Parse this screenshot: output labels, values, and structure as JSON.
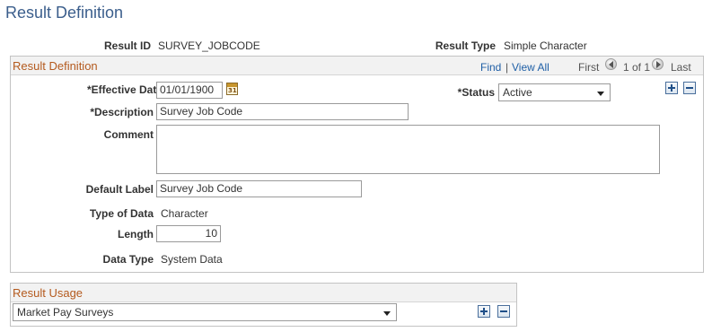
{
  "page": {
    "title": "Result Definition"
  },
  "summary": {
    "result_id_label": "Result ID",
    "result_id_value": "SURVEY_JOBCODE",
    "result_type_label": "Result Type",
    "result_type_value": "Simple Character"
  },
  "definition": {
    "title": "Result Definition",
    "nav": {
      "find": "Find",
      "separator": "|",
      "view_all": "View All",
      "first": "First",
      "count": "1 of 1",
      "last": "Last"
    },
    "effective_date_label": "*Effective Date",
    "effective_date_value": "01/01/1900",
    "calendar_icon_text": "31",
    "status_label": "*Status",
    "status_value": "Active",
    "description_label": "*Description",
    "description_value": "Survey Job Code",
    "comment_label": "Comment",
    "comment_value": "",
    "default_label_label": "Default Label",
    "default_label_value": "Survey Job Code",
    "type_of_data_label": "Type of Data",
    "type_of_data_value": "Character",
    "length_label": "Length",
    "length_value": "10",
    "data_type_label": "Data Type",
    "data_type_value": "System Data"
  },
  "usage": {
    "title": "Result Usage",
    "selected": "Market Pay Surveys"
  },
  "icons": {
    "calendar": "calendar-icon",
    "prev": "chevron-left-icon",
    "next": "chevron-right-icon",
    "add": "plus-icon",
    "remove": "minus-icon",
    "dropdown": "chevron-down-icon"
  },
  "colors": {
    "title_blue": "#3b5e8c",
    "group_title_orange": "#b45a1e",
    "link_blue": "#1f5fa6"
  }
}
